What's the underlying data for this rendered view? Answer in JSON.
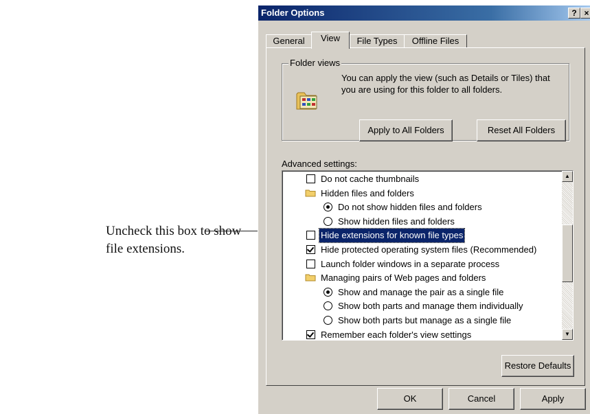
{
  "callout": {
    "line1": "Uncheck this box to show",
    "line2": "file extensions."
  },
  "dialog": {
    "title": "Folder Options",
    "help_glyph": "?",
    "close_glyph": "×",
    "tabs": [
      {
        "label": "General",
        "active": false
      },
      {
        "label": "View",
        "active": true
      },
      {
        "label": "File Types",
        "active": false
      },
      {
        "label": "Offline Files",
        "active": false
      }
    ],
    "folder_views": {
      "legend": "Folder views",
      "description": "You can apply the view (such as Details or Tiles) that you are using for this folder to all folders.",
      "apply_button": "Apply to All Folders",
      "reset_button": "Reset All Folders"
    },
    "advanced_label": "Advanced settings:",
    "advanced_items": [
      {
        "type": "checkbox",
        "checked": false,
        "label": "Do not cache thumbnails"
      },
      {
        "type": "folder",
        "label": "Hidden files and folders"
      },
      {
        "type": "radio",
        "checked": true,
        "label": "Do not show hidden files and folders"
      },
      {
        "type": "radio",
        "checked": false,
        "label": "Show hidden files and folders"
      },
      {
        "type": "checkbox",
        "checked": false,
        "selected": true,
        "label": "Hide extensions for known file types"
      },
      {
        "type": "checkbox",
        "checked": true,
        "label": "Hide protected operating system files (Recommended)"
      },
      {
        "type": "checkbox",
        "checked": false,
        "label": "Launch folder windows in a separate process"
      },
      {
        "type": "folder",
        "label": "Managing pairs of Web pages and folders"
      },
      {
        "type": "radio",
        "checked": true,
        "label": "Show and manage the pair as a single file"
      },
      {
        "type": "radio",
        "checked": false,
        "label": "Show both parts and manage them individually"
      },
      {
        "type": "radio",
        "checked": false,
        "label": "Show both parts but manage as a single file"
      },
      {
        "type": "checkbox",
        "checked": true,
        "label": "Remember each folder's view settings"
      }
    ],
    "restore_defaults": "Restore Defaults",
    "ok": "OK",
    "cancel": "Cancel",
    "apply": "Apply",
    "colors": {
      "title_bar": "#0a246a",
      "face": "#d4d0c8",
      "selection": "#0a246a"
    }
  }
}
